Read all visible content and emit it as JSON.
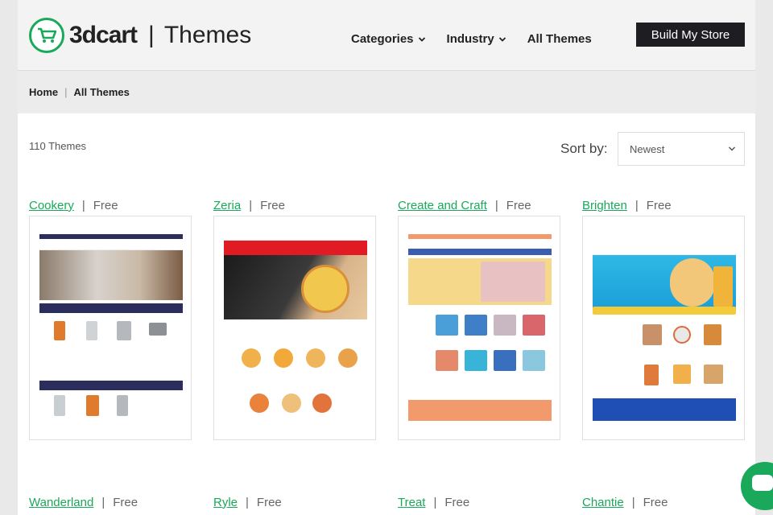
{
  "header": {
    "brand": "3dcart",
    "separator": "|",
    "section": "Themes",
    "nav": [
      {
        "label": "Categories",
        "has_dropdown": true
      },
      {
        "label": "Industry",
        "has_dropdown": true
      },
      {
        "label": "All Themes",
        "has_dropdown": false
      }
    ],
    "cta_label": "Build My Store"
  },
  "breadcrumb": {
    "items": [
      "Home",
      "All Themes"
    ],
    "separator": "|"
  },
  "toolbar": {
    "count": "110 Themes",
    "sort_label": "Sort by:",
    "sort_value": "Newest"
  },
  "themes": [
    {
      "name": "Cookery",
      "price": "Free"
    },
    {
      "name": "Zeria",
      "price": "Free"
    },
    {
      "name": "Create and Craft",
      "price": "Free"
    },
    {
      "name": "Brighten",
      "price": "Free"
    },
    {
      "name": "Wanderland",
      "price": "Free"
    },
    {
      "name": "Ryle",
      "price": "Free"
    },
    {
      "name": "Treat",
      "price": "Free"
    },
    {
      "name": "Chantie",
      "price": "Free"
    }
  ],
  "colors": {
    "accent": "#1aa85a",
    "cta_bg": "#1e1e22",
    "page_bg": "#e9e9e9"
  },
  "icons": {
    "logo": "shopping-cart-icon",
    "dropdown": "chevron-down-icon",
    "select": "chevron-down-icon",
    "chat": "chat-icon"
  }
}
